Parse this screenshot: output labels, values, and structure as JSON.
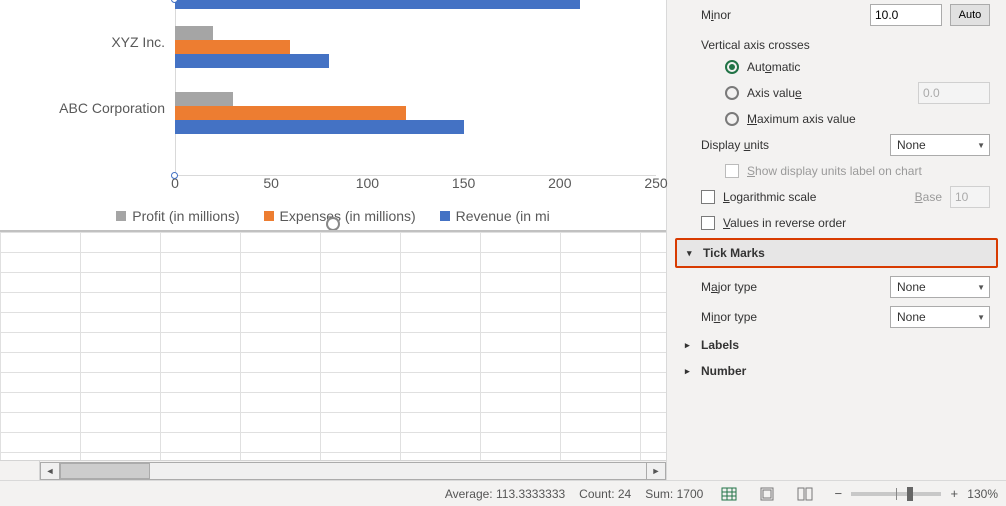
{
  "chart_data": {
    "type": "bar",
    "orientation": "horizontal",
    "categories_visible": [
      "ABC Corporation",
      "XYZ Inc."
    ],
    "series": [
      {
        "name": "Revenue (in millions)",
        "values_visible": {
          "ABC Corporation": 150,
          "XYZ Inc.": 80
        },
        "color": "#4472c4"
      },
      {
        "name": "Expenses (in millions)",
        "values_visible": {
          "ABC Corporation": 120,
          "XYZ Inc.": 60
        },
        "color": "#ed7d31"
      },
      {
        "name": "Profit (in millions)",
        "values_visible": {
          "ABC Corporation": 30,
          "XYZ Inc.": 20
        },
        "color": "#a5a5a5"
      }
    ],
    "xlim": [
      0,
      250
    ],
    "xticks": [
      0,
      50,
      100,
      150,
      200,
      250
    ],
    "legend_position": "bottom"
  },
  "legend": {
    "profit": "Profit (in millions)",
    "expenses": "Expenses (in millions)",
    "revenue": "Revenue (in mi"
  },
  "ylabels": {
    "abc": "ABC Corporation",
    "xyz": "XYZ Inc."
  },
  "xticks": {
    "t0": "0",
    "t1": "50",
    "t2": "100",
    "t3": "150",
    "t4": "200",
    "t5": "250"
  },
  "panel": {
    "minor_label": "Minor",
    "minor_value": "10.0",
    "auto_btn": "Auto",
    "vcross_title": "Vertical axis crosses",
    "opt_auto": "Automatic",
    "opt_axisval": "Axis value",
    "opt_maxaxis": "Maximum axis value",
    "axisval_value": "0.0",
    "display_units": "Display units",
    "display_units_value": "None",
    "show_units_label": "Show display units label on chart",
    "log_label": "Logarithmic scale",
    "base_label": "Base",
    "base_value": "10",
    "reverse_label": "Values in reverse order",
    "sec_tick": "Tick Marks",
    "major_type": "Major type",
    "major_type_value": "None",
    "minor_type": "Minor type",
    "minor_type_value": "None",
    "sec_labels": "Labels",
    "sec_number": "Number"
  },
  "status": {
    "average_label": "Average:",
    "average_value": "113.3333333",
    "count_label": "Count:",
    "count_value": "24",
    "sum_label": "Sum:",
    "sum_value": "1700",
    "zoom": "130%"
  }
}
